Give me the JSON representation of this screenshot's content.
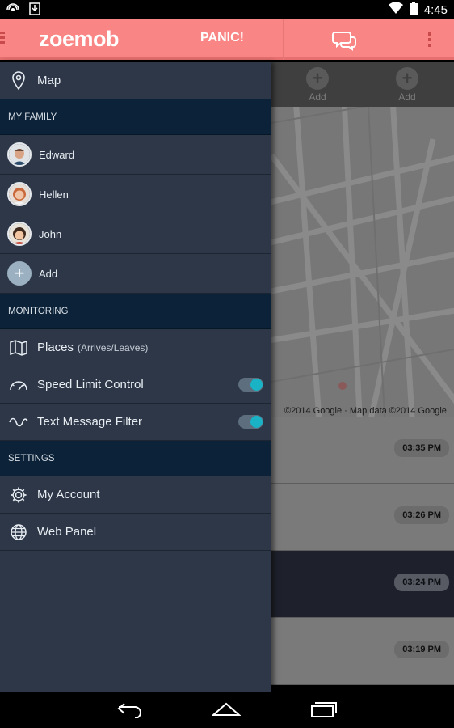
{
  "status_bar": {
    "time": "4:45"
  },
  "app_bar": {
    "logo": "zoemob",
    "panic_label": "PANIC!"
  },
  "drawer": {
    "map_label": "Map",
    "family_header": "MY FAMILY",
    "members": [
      {
        "name": "Edward"
      },
      {
        "name": "Hellen"
      },
      {
        "name": "John"
      }
    ],
    "add_label": "Add",
    "monitoring_header": "MONITORING",
    "places_label": "Places",
    "places_sub": "(Arrives/Leaves)",
    "speed_label": "Speed Limit Control",
    "speed_enabled": true,
    "sms_label": "Text Message Filter",
    "sms_enabled": true,
    "settings_header": "SETTINGS",
    "account_label": "My Account",
    "web_label": "Web Panel"
  },
  "background": {
    "add_labels": [
      "Add",
      "Add"
    ],
    "map_copyright": "©2014 Google · Map data ©2014 Google",
    "times": [
      "03:35 PM",
      "03:26 PM",
      "03:24 PM",
      "03:19 PM"
    ]
  },
  "colors": {
    "app_bar": "#f98585",
    "drawer": "#2d3748",
    "section": "#0c2238",
    "toggle_on": "#1ab3c6"
  }
}
